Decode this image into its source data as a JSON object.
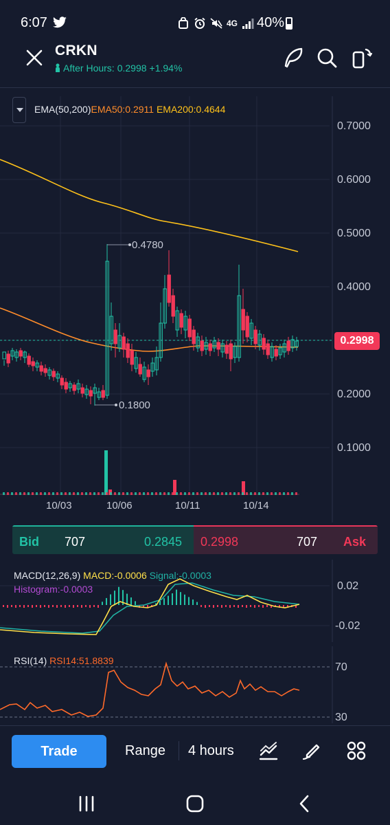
{
  "status_bar": {
    "time": "6:07",
    "network": "4G",
    "battery": "40%",
    "icons": [
      "twitter-icon",
      "bag-icon",
      "alarm-icon",
      "mute-icon",
      "signal-icon",
      "battery-icon"
    ]
  },
  "header": {
    "ticker": "CRKN",
    "after_hours_label": "After Hours:",
    "after_hours_price": "0.2998",
    "after_hours_change": "+1.94%",
    "icons": [
      "close-icon",
      "feather-icon",
      "search-icon",
      "rotate-icon"
    ]
  },
  "colors": {
    "background": "#151b2d",
    "up": "#22c3a6",
    "down": "#f23858",
    "ema50": "#ff8c2a",
    "ema200": "#ffc21a",
    "macd": "#ffe14a",
    "signal": "#21b3a5",
    "histogram": "#b44bd4",
    "rsi": "#ff6a2a",
    "trade_button": "#2d8cf0"
  },
  "indicator": {
    "name": "EMA(50,200)",
    "ema50_label": "EMA50:0.2911",
    "ema200_label": "EMA200:0.4644"
  },
  "price_axis": [
    "0.7000",
    "0.6000",
    "0.5000",
    "0.4000",
    "0.3000",
    "0.2000",
    "0.1000"
  ],
  "current_price": "0.2998",
  "annotations": {
    "high": "0.4780",
    "low": "0.1800"
  },
  "date_axis": [
    "10/03",
    "10/06",
    "10/11",
    "10/14"
  ],
  "bid_ask": {
    "bid_label": "Bid",
    "bid_size": "707",
    "bid_price": "0.2845",
    "ask_price": "0.2998",
    "ask_size": "707",
    "ask_label": "Ask"
  },
  "macd": {
    "name": "MACD(12,26,9)",
    "macd_label": "MACD:-0.0006",
    "signal_label": "Signal:-0.0003",
    "histogram_label": "Histogram:-0.0003",
    "axis": [
      "0.02",
      "-0.02"
    ]
  },
  "rsi": {
    "name": "RSI(14)",
    "value_label": "RSI14:51.8839",
    "axis": [
      "70",
      "30"
    ]
  },
  "toolbar": {
    "trade": "Trade",
    "range": "Range",
    "interval": "4 hours",
    "icons": [
      "indicator-icon",
      "draw-icon",
      "grid-icon"
    ]
  },
  "nav": {
    "icons": [
      "recent-apps-icon",
      "home-icon",
      "back-icon"
    ]
  }
}
